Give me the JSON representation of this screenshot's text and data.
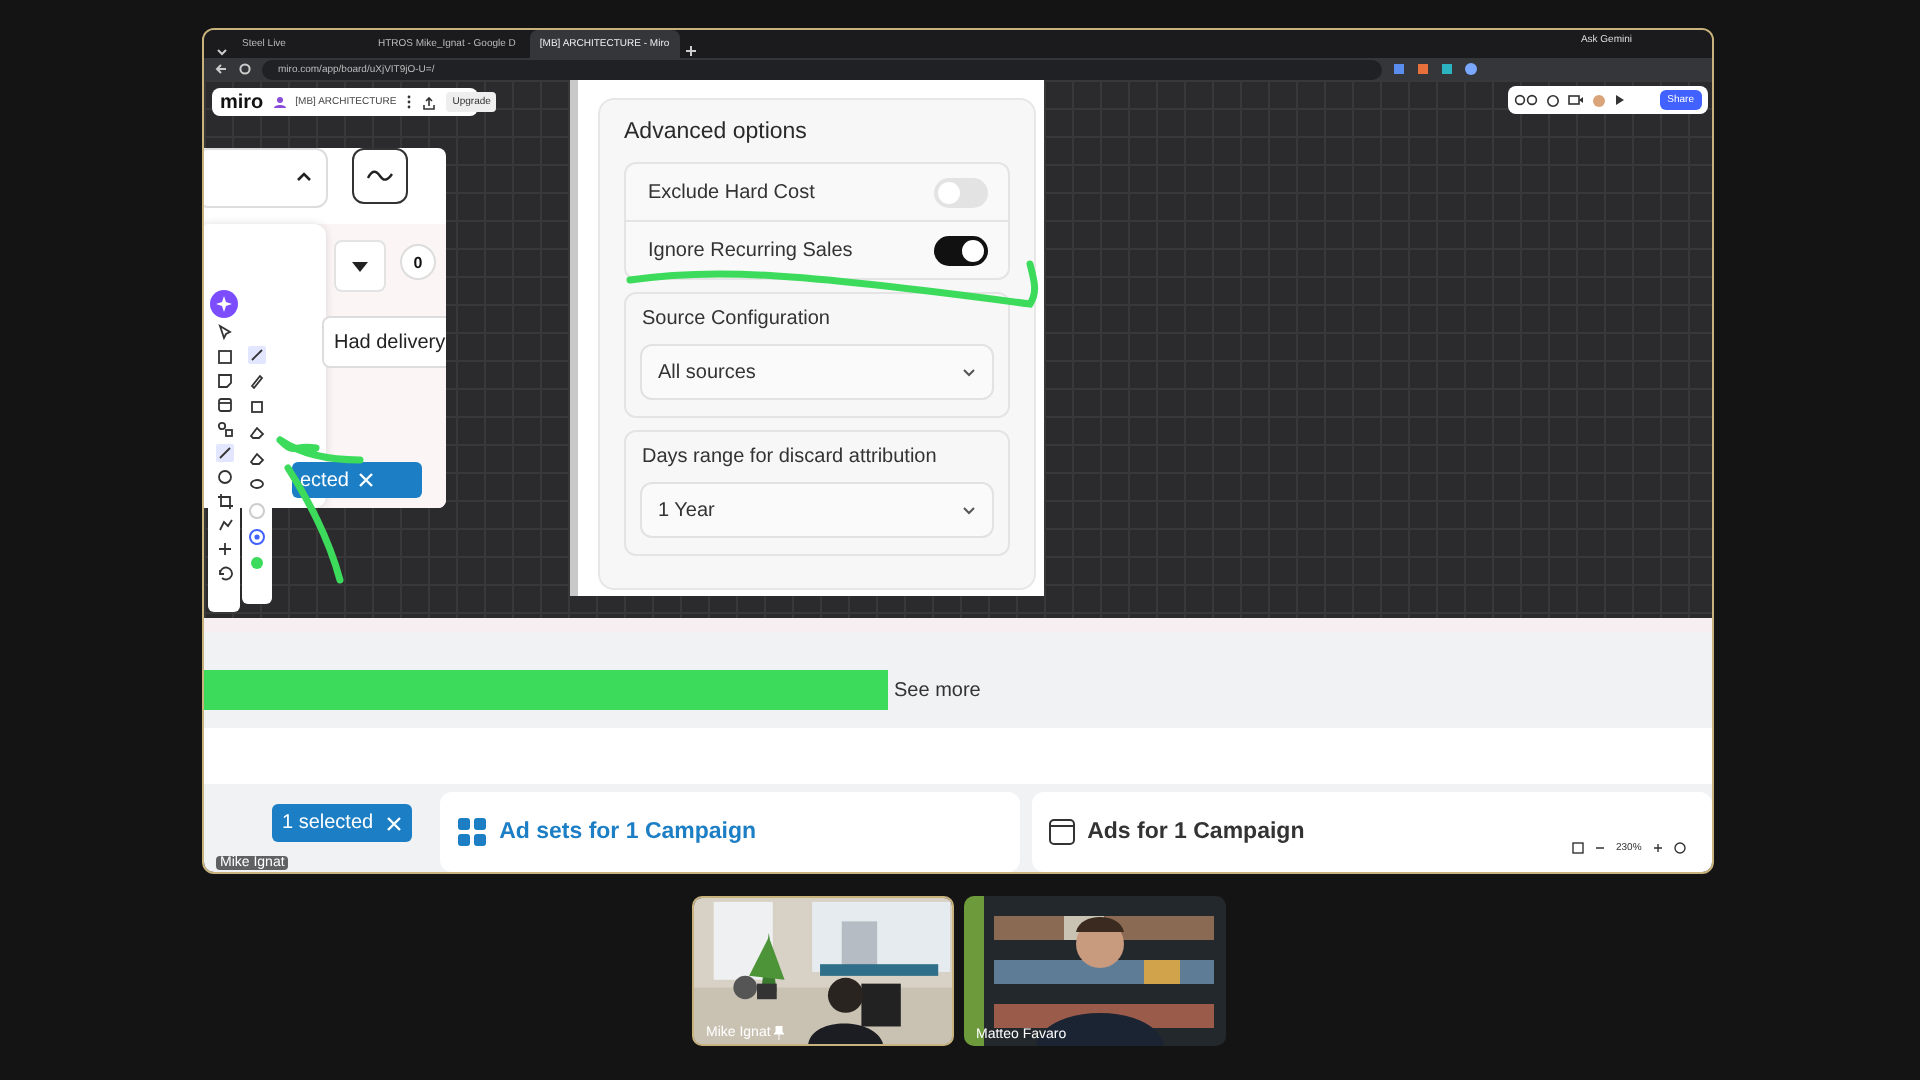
{
  "browser": {
    "tabs": [
      {
        "title": "Steel Live",
        "selected": false
      },
      {
        "title": "HTROS Mike_Ignat - Google D",
        "selected": false
      },
      {
        "title": "[MB] ARCHITECTURE - Miro",
        "selected": true
      }
    ],
    "gemini": "Ask Gemini",
    "address": "miro.com/app/board/uXjVIT9jO-U=/"
  },
  "miro": {
    "logo": "miro",
    "board": "[MB] ARCHITECTURE",
    "upgrade": "Upgrade",
    "share": "Share",
    "zoom": "230%"
  },
  "left_card": {
    "counter": "0",
    "chip": "Had delivery",
    "selected_button": "ected"
  },
  "advanced": {
    "title": "Advanced options",
    "toggles": [
      {
        "label": "Exclude Hard Cost",
        "on": false
      },
      {
        "label": "Ignore Recurring Sales",
        "on": true
      }
    ],
    "selects": [
      {
        "label": "Source Configuration",
        "value": "All sources"
      },
      {
        "label": "Days range for discard attribution",
        "value": "1 Year"
      }
    ]
  },
  "lower": {
    "see_more": "See more",
    "selected_chip": "1 selected",
    "panels": [
      {
        "title": "Ad sets for 1 Campaign",
        "selected": true
      },
      {
        "title": "Ads for 1 Campaign",
        "selected": false
      }
    ]
  },
  "presenter_label": "Mike Ignat",
  "participants": [
    {
      "name": "Mike Ignat",
      "pinned": true,
      "speaking": true
    },
    {
      "name": "Matteo Favaro",
      "pinned": false,
      "speaking": false
    }
  ]
}
